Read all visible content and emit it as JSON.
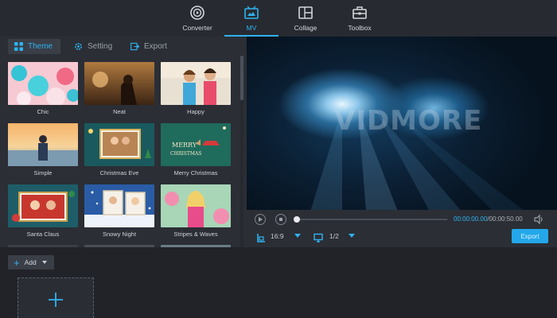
{
  "nav": {
    "items": [
      {
        "label": "Converter",
        "icon": "converter-icon"
      },
      {
        "label": "MV",
        "icon": "mv-icon",
        "active": true
      },
      {
        "label": "Collage",
        "icon": "collage-icon"
      },
      {
        "label": "Toolbox",
        "icon": "toolbox-icon"
      }
    ]
  },
  "tabs": [
    {
      "label": "Theme",
      "icon": "theme-grid-icon",
      "active": true
    },
    {
      "label": "Setting",
      "icon": "gear-icon"
    },
    {
      "label": "Export",
      "icon": "export-icon"
    }
  ],
  "themes": [
    {
      "name": "Chic"
    },
    {
      "name": "Neat"
    },
    {
      "name": "Happy"
    },
    {
      "name": "Simple"
    },
    {
      "name": "Christmas Eve"
    },
    {
      "name": "Merry Christmas"
    },
    {
      "name": "Santa Claus"
    },
    {
      "name": "Snowy Night"
    },
    {
      "name": "Stripes & Waves"
    }
  ],
  "preview": {
    "watermark": "VIDMORE"
  },
  "player": {
    "current_time": "00:00:00.00",
    "total_time": "/00:00:50.00",
    "aspect_ratio": "16:9",
    "page": "1/2",
    "export_label": "Export"
  },
  "bottom": {
    "add_label": "Add"
  },
  "colors": {
    "accent": "#2fb3f0",
    "background": "#23262d",
    "panel": "#2b2e35"
  }
}
